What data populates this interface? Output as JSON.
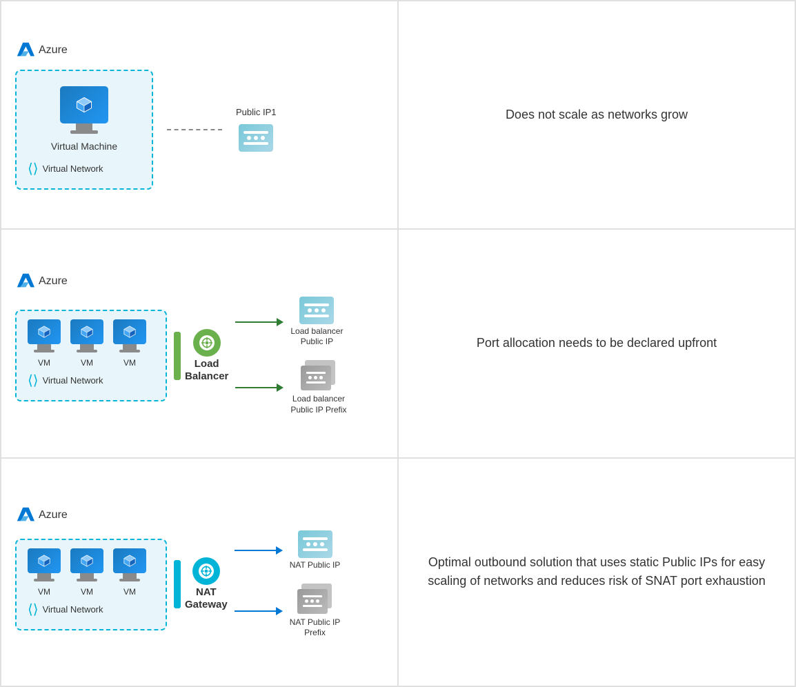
{
  "rows": [
    {
      "diagram": {
        "azure_label": "Azure",
        "vnet_label": "Virtual Network",
        "vm_label": "Virtual Machine",
        "public_ip_label": "Public IP1",
        "connection_type": "dashed"
      },
      "description": "Does not scale as networks grow"
    },
    {
      "diagram": {
        "azure_label": "Azure",
        "vnet_label": "Virtual Network",
        "vm_labels": [
          "VM",
          "VM",
          "VM"
        ],
        "balancer_name": "Load\nBalancer",
        "balancer_name_line1": "Load",
        "balancer_name_line2": "Balancer",
        "target1_label": "Load balancer\nPublic IP",
        "target1_label_line1": "Load balancer",
        "target1_label_line2": "Public IP",
        "target2_label": "Load balancer\nPublic IP Prefix",
        "target2_label_line1": "Load balancer",
        "target2_label_line2": "Public IP Prefix"
      },
      "description": "Port allocation needs to be declared upfront"
    },
    {
      "diagram": {
        "azure_label": "Azure",
        "vnet_label": "Virtual Network",
        "vm_labels": [
          "VM",
          "VM",
          "VM"
        ],
        "gateway_name_line1": "NAT",
        "gateway_name_line2": "Gateway",
        "target1_label_line1": "NAT Public IP",
        "target2_label_line1": "NAT Public IP",
        "target2_label_line2": "Prefix"
      },
      "description": "Optimal outbound solution that uses static Public IPs for easy scaling of networks and reduces risk of SNAT port exhaustion"
    }
  ],
  "colors": {
    "azure_blue": "#0078d4",
    "vnet_border": "#00b4d8",
    "vnet_bg": "#e8f6fb",
    "green": "#6ab04c",
    "nat_blue": "#00b4d8",
    "arrow_green": "#2e7d32",
    "arrow_blue": "#0078d4"
  }
}
